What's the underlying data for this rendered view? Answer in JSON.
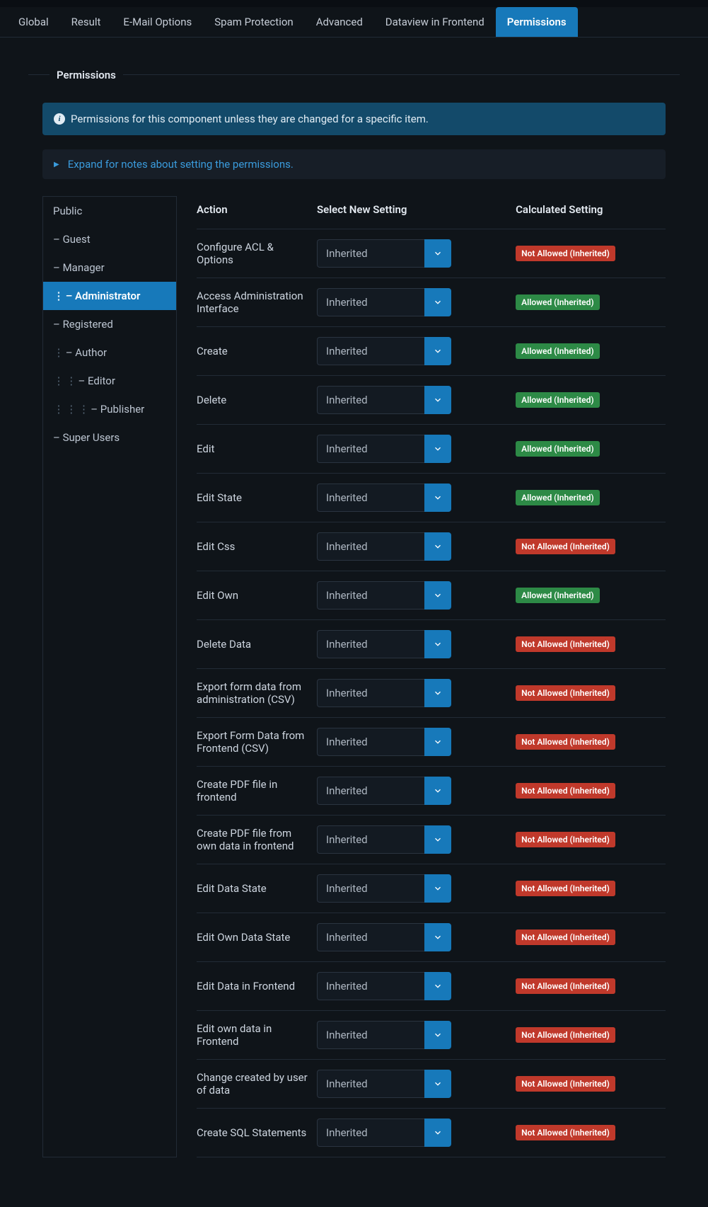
{
  "tabs": [
    {
      "label": "Global"
    },
    {
      "label": "Result"
    },
    {
      "label": "E-Mail Options"
    },
    {
      "label": "Spam Protection"
    },
    {
      "label": "Advanced"
    },
    {
      "label": "Dataview in Frontend"
    },
    {
      "label": "Permissions",
      "active": true
    }
  ],
  "legend": "Permissions",
  "info_text": "Permissions for this component unless they are changed for a specific item.",
  "expand_text": "Expand for notes about setting the permissions.",
  "sidebar": [
    {
      "label": "Public",
      "indent": 0,
      "handle": false,
      "active": false
    },
    {
      "label": "– Guest",
      "indent": 0,
      "handle": false,
      "active": false
    },
    {
      "label": "– Manager",
      "indent": 0,
      "handle": false,
      "active": false
    },
    {
      "label": "– Administrator",
      "indent": 1,
      "handle": true,
      "active": true
    },
    {
      "label": "– Registered",
      "indent": 0,
      "handle": false,
      "active": false
    },
    {
      "label": "– Author",
      "indent": 1,
      "handle": true,
      "active": false
    },
    {
      "label": "– Editor",
      "indent": 2,
      "handle": true,
      "active": false
    },
    {
      "label": "– Publisher",
      "indent": 3,
      "handle": true,
      "active": false
    },
    {
      "label": "– Super Users",
      "indent": 0,
      "handle": false,
      "active": false
    }
  ],
  "headers": {
    "action": "Action",
    "select": "Select New Setting",
    "calc": "Calculated Setting"
  },
  "select_value": "Inherited",
  "badges": {
    "na": "Not Allowed (Inherited)",
    "al": "Allowed (Inherited)"
  },
  "rows": [
    {
      "action": "Configure ACL & Options",
      "status": "na"
    },
    {
      "action": "Access Administration Interface",
      "status": "al"
    },
    {
      "action": "Create",
      "status": "al"
    },
    {
      "action": "Delete",
      "status": "al"
    },
    {
      "action": "Edit",
      "status": "al"
    },
    {
      "action": "Edit State",
      "status": "al"
    },
    {
      "action": "Edit Css",
      "status": "na"
    },
    {
      "action": "Edit Own",
      "status": "al"
    },
    {
      "action": "Delete Data",
      "status": "na"
    },
    {
      "action": "Export form data from administration (CSV)",
      "status": "na"
    },
    {
      "action": "Export Form Data from Frontend (CSV)",
      "status": "na"
    },
    {
      "action": "Create PDF file in frontend",
      "status": "na"
    },
    {
      "action": "Create PDF file from own data in frontend",
      "status": "na"
    },
    {
      "action": "Edit Data State",
      "status": "na"
    },
    {
      "action": "Edit Own Data State",
      "status": "na"
    },
    {
      "action": "Edit Data in Frontend",
      "status": "na"
    },
    {
      "action": "Edit own data in Frontend",
      "status": "na"
    },
    {
      "action": "Change created by user of data",
      "status": "na"
    },
    {
      "action": "Create SQL Statements",
      "status": "na"
    }
  ]
}
